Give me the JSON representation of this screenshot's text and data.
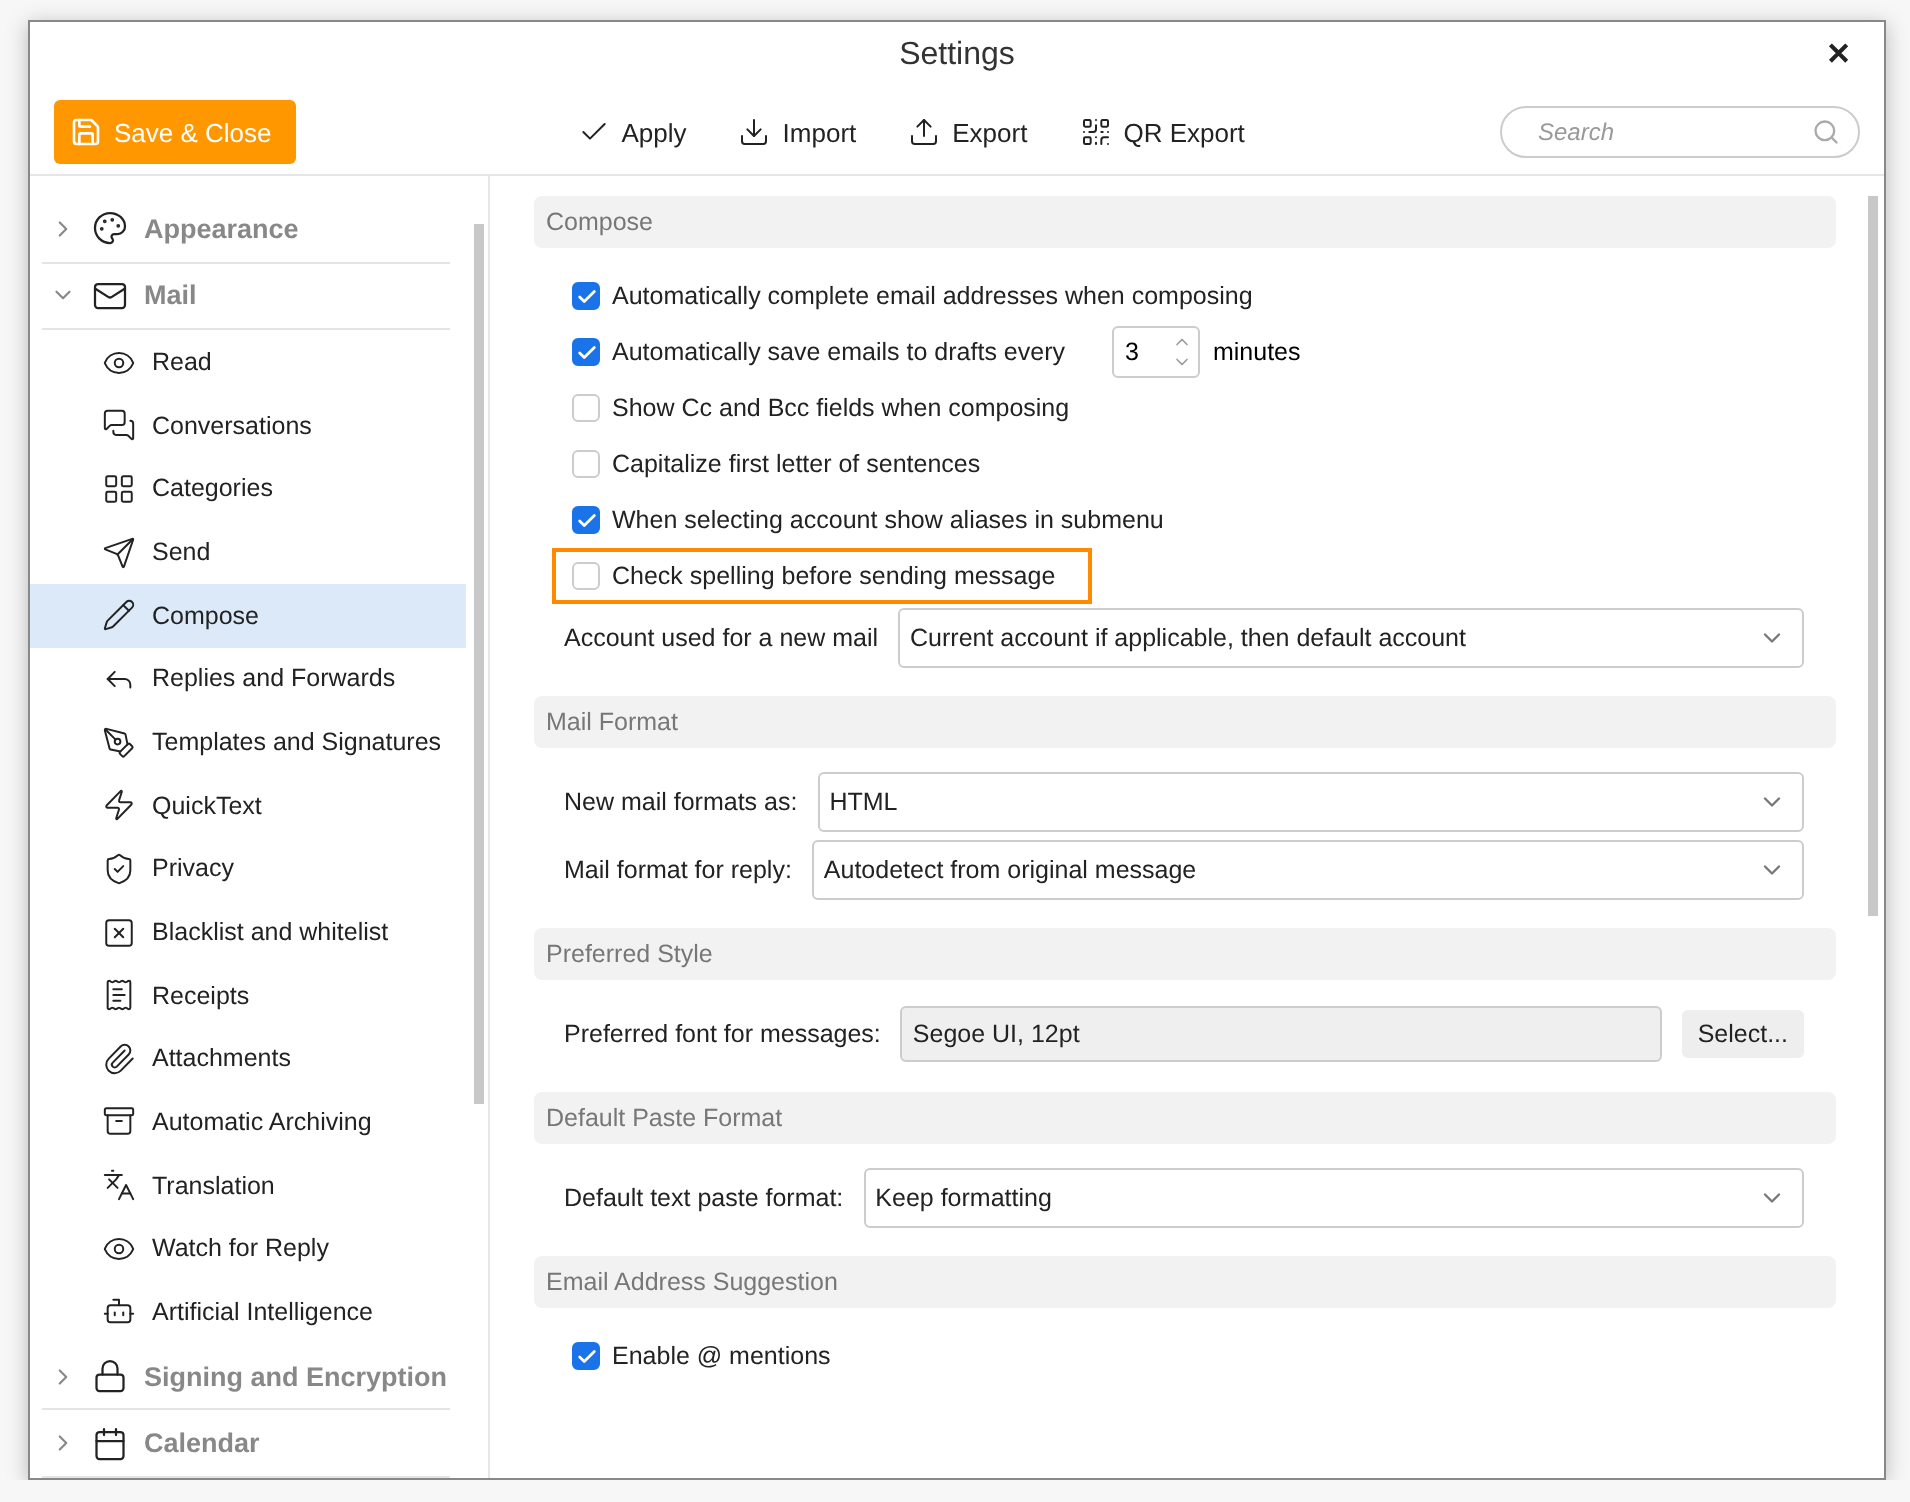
{
  "window": {
    "title": "Settings",
    "close": "✕"
  },
  "toolbar": {
    "save_button": "Save & Close",
    "actions": [
      {
        "label": "Apply"
      },
      {
        "label": "Import"
      },
      {
        "label": "Export"
      },
      {
        "label": "QR Export"
      }
    ],
    "search": {
      "placeholder": "Search"
    }
  },
  "sidebar": {
    "groups": [
      {
        "label": "Appearance",
        "expanded": false
      },
      {
        "label": "Mail",
        "expanded": true,
        "children": [
          {
            "label": "Read",
            "selected": false
          },
          {
            "label": "Conversations",
            "selected": false
          },
          {
            "label": "Categories",
            "selected": false
          },
          {
            "label": "Send",
            "selected": false
          },
          {
            "label": "Compose",
            "selected": true
          },
          {
            "label": "Replies and Forwards",
            "selected": false
          },
          {
            "label": "Templates and Signatures",
            "selected": false
          },
          {
            "label": "QuickText",
            "selected": false
          },
          {
            "label": "Privacy",
            "selected": false
          },
          {
            "label": "Blacklist and whitelist",
            "selected": false
          },
          {
            "label": "Receipts",
            "selected": false
          },
          {
            "label": "Attachments",
            "selected": false
          },
          {
            "label": "Automatic Archiving",
            "selected": false
          },
          {
            "label": "Translation",
            "selected": false
          },
          {
            "label": "Watch for Reply",
            "selected": false
          },
          {
            "label": "Artificial Intelligence",
            "selected": false
          }
        ]
      },
      {
        "label": "Signing and Encryption",
        "expanded": false
      },
      {
        "label": "Calendar",
        "expanded": false
      }
    ]
  },
  "sections": [
    {
      "title": "Compose",
      "rows": [
        {
          "kind": "checkbox",
          "label": "Automatically complete email addresses when composing",
          "checked": true,
          "highlighted": false
        },
        {
          "kind": "spinner",
          "label": "Automatically save emails to drafts every",
          "checked": true,
          "highlighted": false,
          "value": "3",
          "suffix": "minutes"
        },
        {
          "kind": "checkbox",
          "label": "Show Cc and Bcc fields when composing",
          "checked": false,
          "highlighted": false
        },
        {
          "kind": "checkbox",
          "label": "Capitalize first letter of sentences",
          "checked": false,
          "highlighted": false
        },
        {
          "kind": "checkbox",
          "label": "When selecting account show aliases in submenu",
          "checked": true,
          "highlighted": false
        },
        {
          "kind": "checkbox",
          "label": "Check spelling before sending message",
          "checked": false,
          "highlighted": true
        },
        {
          "kind": "select",
          "label": "Account used for a new mail",
          "value": "Current account if applicable, then default account"
        }
      ]
    },
    {
      "title": "Mail Format",
      "rows": [
        {
          "kind": "select",
          "label": "New mail formats as:",
          "value": "HTML"
        },
        {
          "kind": "select",
          "label": "Mail format for reply:",
          "value": "Autodetect from original message"
        }
      ]
    },
    {
      "title": "Preferred Style",
      "rows": [
        {
          "kind": "font",
          "label": "Preferred font for messages:",
          "value": "Segoe UI, 12pt",
          "button": "Select..."
        }
      ]
    },
    {
      "title": "Default Paste Format",
      "rows": [
        {
          "kind": "select",
          "label": "Default text paste format:",
          "value": "Keep formatting"
        }
      ]
    },
    {
      "title": "Email Address Suggestion",
      "rows": [
        {
          "kind": "checkbox",
          "label": "Enable @ mentions",
          "checked": true,
          "highlighted": false
        }
      ]
    }
  ]
}
